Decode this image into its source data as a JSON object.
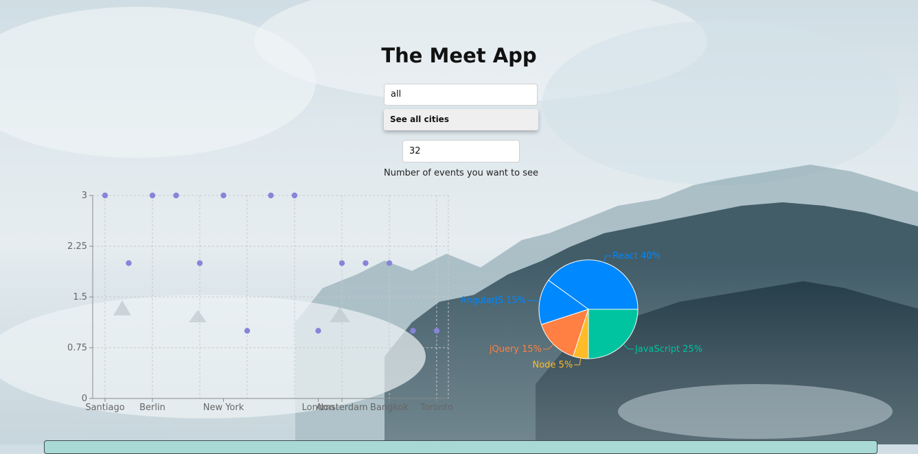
{
  "app": {
    "title": "The Meet App"
  },
  "city_search": {
    "value": "all",
    "suggestion": "See all cities"
  },
  "number_of_events": {
    "value": "32",
    "label": "Number of events you want to see"
  },
  "chart_data": [
    {
      "type": "scatter",
      "title": "",
      "xlabel": "",
      "ylabel": "",
      "ylim": [
        0,
        3
      ],
      "y_ticks": [
        "0",
        "0.75",
        "1.5",
        "2.25",
        "3"
      ],
      "grid": true,
      "x_tick_labels": [
        "Santiago",
        "Berlin",
        "New York",
        "London",
        "Amsterdam",
        "Bangkok",
        "Toronto"
      ],
      "points": [
        {
          "x": 0,
          "y": 3
        },
        {
          "x": 1,
          "y": 2
        },
        {
          "x": 2,
          "y": 3
        },
        {
          "x": 3,
          "y": 3
        },
        {
          "x": 4,
          "y": 2
        },
        {
          "x": 5,
          "y": 3
        },
        {
          "x": 6,
          "y": 1
        },
        {
          "x": 7,
          "y": 3
        },
        {
          "x": 8,
          "y": 3
        },
        {
          "x": 9,
          "y": 1
        },
        {
          "x": 10,
          "y": 2
        },
        {
          "x": 11,
          "y": 2
        },
        {
          "x": 12,
          "y": 2
        },
        {
          "x": 13,
          "y": 1
        },
        {
          "x": 14,
          "y": 1
        }
      ],
      "point_color": "#8884d8"
    },
    {
      "type": "pie",
      "slices": [
        {
          "name": "React",
          "percent": 40,
          "color": "#0088FE",
          "label": "React 40%"
        },
        {
          "name": "AngularJS",
          "percent": 15,
          "color": "#0088FE",
          "label": "AngularJS 15%"
        },
        {
          "name": "jQuery",
          "percent": 15,
          "color": "#FF8042",
          "label": "jQuery 15%"
        },
        {
          "name": "Node",
          "percent": 5,
          "color": "#FFBB28",
          "label": "Node 5%"
        },
        {
          "name": "JavaScript",
          "percent": 25,
          "color": "#00C49F",
          "label": "JavaScript 25%"
        }
      ]
    }
  ]
}
